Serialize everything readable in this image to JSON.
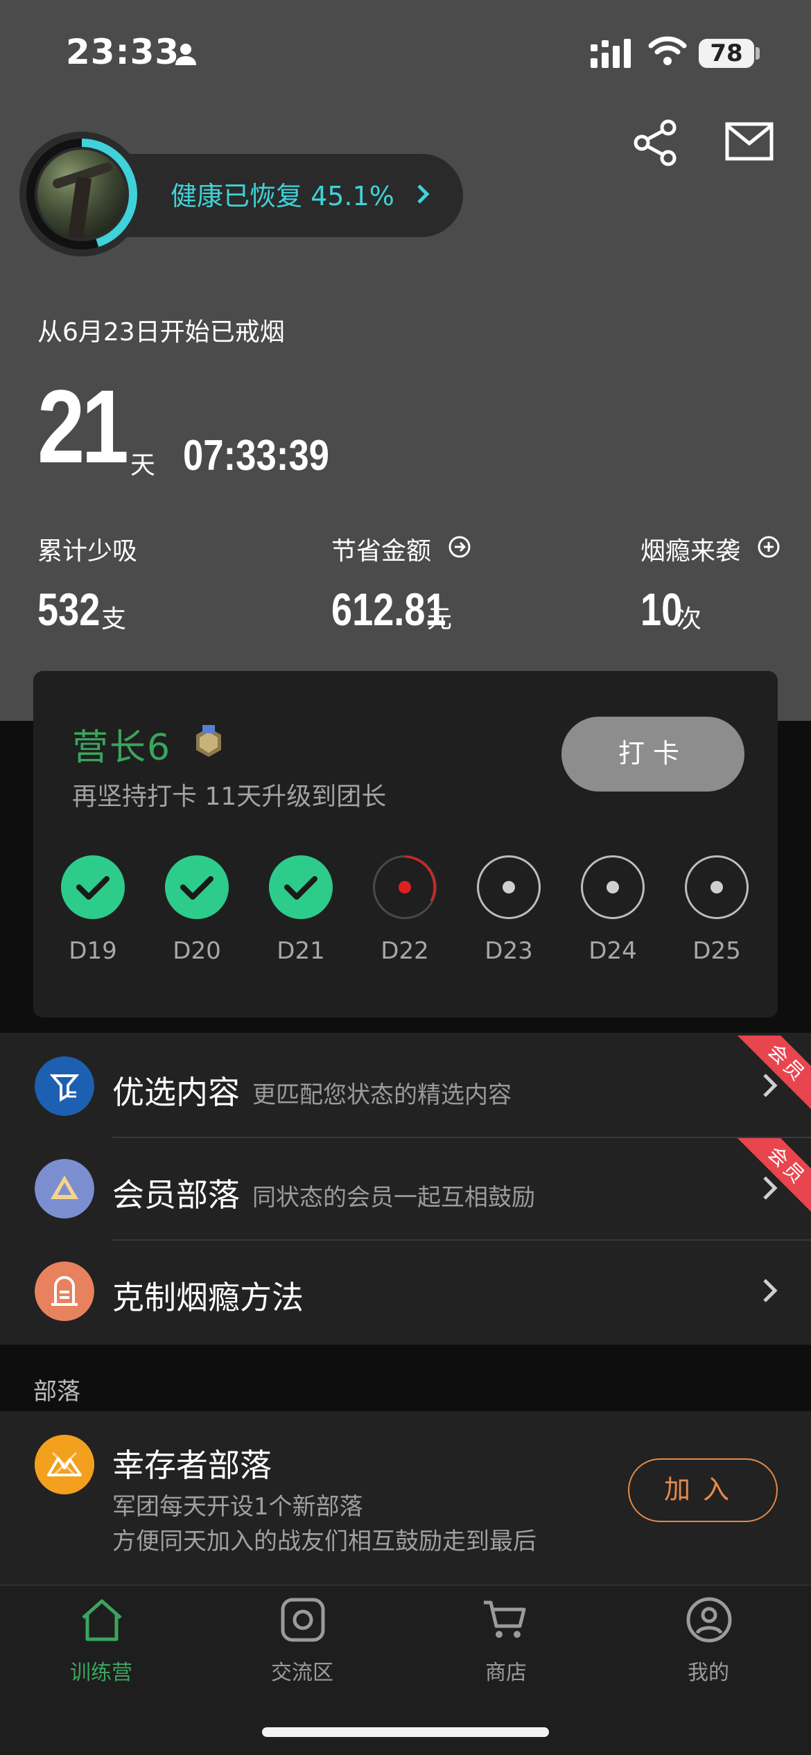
{
  "status_bar": {
    "time": "23:33",
    "battery": "78"
  },
  "header": {
    "health_label": "健康已恢复 45.1%",
    "health_progress": 0.451
  },
  "quit": {
    "since": "从6月23日开始已戒烟",
    "days": "21",
    "days_unit": "天",
    "timer": "07:33:39"
  },
  "stats": [
    {
      "label": "累计少吸",
      "value": "532",
      "unit": "支",
      "icon": ""
    },
    {
      "label": "节省金额",
      "value": "612.81",
      "unit": "元",
      "icon": "arrow-right-circle-icon"
    },
    {
      "label": "烟瘾来袭",
      "value": "10",
      "unit": "次",
      "icon": "plus-circle-icon"
    }
  ],
  "card": {
    "rank": "营长6",
    "subtitle": "再坚持打卡 11天升级到团长",
    "checkin_button": "打卡",
    "days": [
      {
        "label": "D19",
        "state": "done"
      },
      {
        "label": "D20",
        "state": "done"
      },
      {
        "label": "D21",
        "state": "done"
      },
      {
        "label": "D22",
        "state": "current"
      },
      {
        "label": "D23",
        "state": "todo"
      },
      {
        "label": "D24",
        "state": "todo"
      },
      {
        "label": "D25",
        "state": "todo"
      }
    ]
  },
  "menu": [
    {
      "title": "优选内容",
      "subtitle": "更匹配您状态的精选内容",
      "badge": "会员",
      "icon_color": "#1d5fb0"
    },
    {
      "title": "会员部落",
      "subtitle": "同状态的会员一起互相鼓励",
      "badge": "会员",
      "icon_color": "#7b8fd0"
    },
    {
      "title": "克制烟瘾方法",
      "subtitle": "",
      "badge": "",
      "icon_color": "#e8825e"
    }
  ],
  "section": {
    "label": "部落"
  },
  "tribe": {
    "title": "幸存者部落",
    "line1": "军团每天开设1个新部落",
    "line2": "方便同天加入的战友们相互鼓励走到最后",
    "join_button": "加入"
  },
  "tabs": [
    {
      "label": "训练营",
      "icon": "home-icon",
      "active": true
    },
    {
      "label": "交流区",
      "icon": "camera-square-icon",
      "active": false
    },
    {
      "label": "商店",
      "icon": "cart-icon",
      "active": false
    },
    {
      "label": "我的",
      "icon": "profile-icon",
      "active": false
    }
  ],
  "colors": {
    "accent_green": "#3aa55d",
    "done_green": "#2ecc8a",
    "health_cyan": "#3fd2d8",
    "member_red": "#e8454e",
    "join_orange": "#e58a4a"
  }
}
